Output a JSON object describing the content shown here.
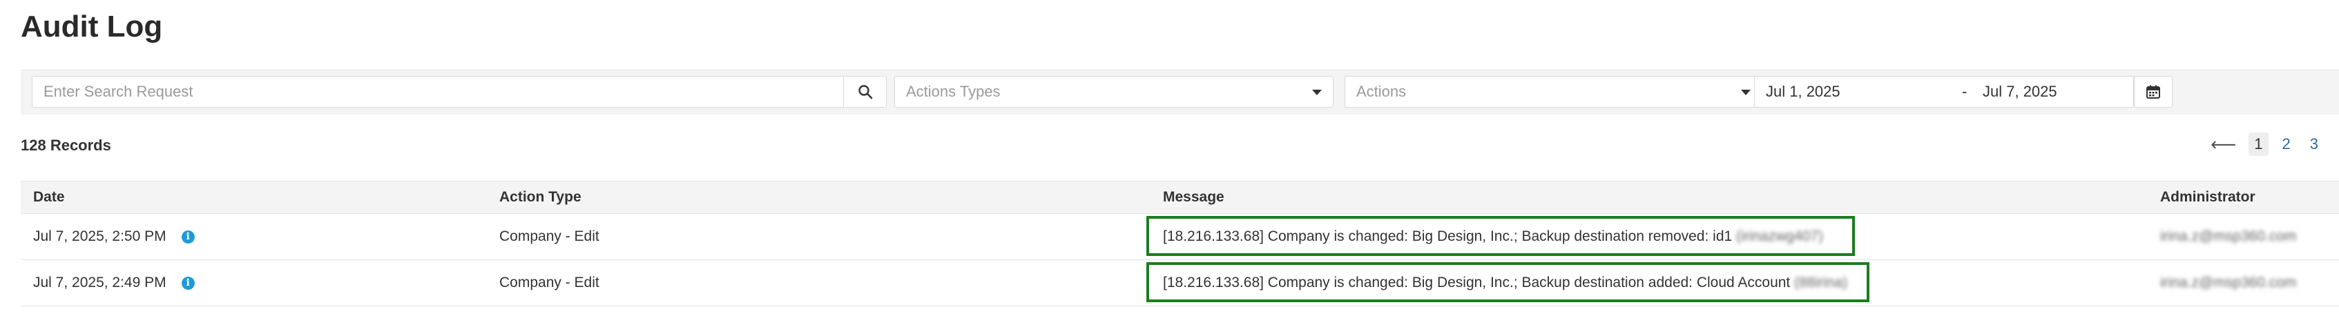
{
  "page": {
    "title": "Audit Log"
  },
  "filters": {
    "search_placeholder": "Enter Search Request",
    "action_types_placeholder": "Actions Types",
    "actions_placeholder": "Actions",
    "date_from": "Jul 1, 2025",
    "date_separator": "-",
    "date_to": "Jul 7, 2025"
  },
  "records": {
    "count_label": "128 Records"
  },
  "pagination": {
    "prev": "⟵",
    "pages": [
      "1",
      "2",
      "3"
    ],
    "active": "1"
  },
  "table": {
    "columns": {
      "date": "Date",
      "action_type": "Action Type",
      "message": "Message",
      "administrator": "Administrator"
    },
    "rows": [
      {
        "date": "Jul 7, 2025, 2:50 PM",
        "action_type": "Company - Edit",
        "message": "[18.216.133.68] Company is changed: Big Design, Inc.; Backup destination removed: id1",
        "message_redacted": "(irinazwg407)",
        "administrator": "irina.z@msp360.com"
      },
      {
        "date": "Jul 7, 2025, 2:49 PM",
        "action_type": "Company - Edit",
        "message": "[18.216.133.68] Company is changed: Big Design, Inc.; Backup destination added: Cloud Account",
        "message_redacted": "(88irina)",
        "administrator": "irina.z@msp360.com"
      }
    ]
  },
  "colors": {
    "highlight": "#1a7d1f",
    "info": "#1e9bd7",
    "link": "#2b6aa5"
  }
}
